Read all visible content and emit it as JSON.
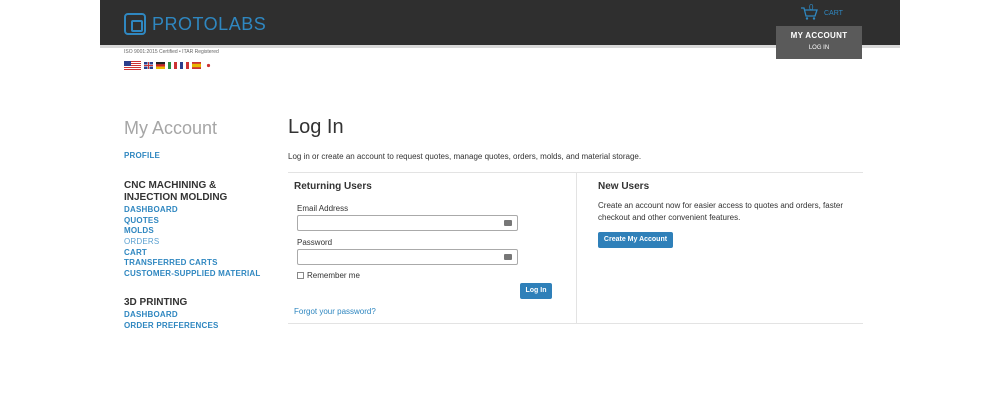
{
  "header": {
    "brand": "PROTOLABS",
    "cart_count": "0",
    "cart_label": "CART",
    "account_title": "MY ACCOUNT",
    "account_login": "LOG IN",
    "iso_text": "ISO 9001:2015 Certified • ITAR Registered",
    "flags": [
      "us-flag",
      "uk-flag",
      "de-flag",
      "it-flag",
      "fr-flag",
      "es-flag",
      "jp-flag"
    ]
  },
  "sidebar": {
    "title": "My Account",
    "profile": "PROFILE",
    "cnc_heading": "CNC MACHINING &\nINJECTION MOLDING",
    "cnc_heading_line1": "CNC MACHINING &",
    "cnc_heading_line2": "INJECTION MOLDING",
    "cnc_links": [
      "DASHBOARD",
      "QUOTES",
      "MOLDS",
      "ORDERS",
      "CART",
      "TRANSFERRED CARTS",
      "CUSTOMER-SUPPLIED MATERIAL"
    ],
    "printing_heading": "3D PRINTING",
    "printing_links": [
      "DASHBOARD",
      "ORDER PREFERENCES"
    ]
  },
  "main": {
    "title": "Log In",
    "intro": "Log in or create an account to request quotes, manage quotes, orders, molds, and material storage.",
    "returning": {
      "heading": "Returning Users",
      "email_label": "Email Address",
      "email_value": "",
      "password_label": "Password",
      "password_value": "",
      "remember_label": "Remember me",
      "login_button": "Log In",
      "forgot_link": "Forgot your password?"
    },
    "new_users": {
      "heading": "New Users",
      "description": "Create an account now for easier access to quotes and orders, faster checkout and other convenient features.",
      "create_button": "Create My Account"
    }
  },
  "colors": {
    "accent": "#2f87c0",
    "header_bg": "#2f2f2f",
    "account_bg": "#5a5a5a",
    "button_bg": "#2f80b9"
  }
}
